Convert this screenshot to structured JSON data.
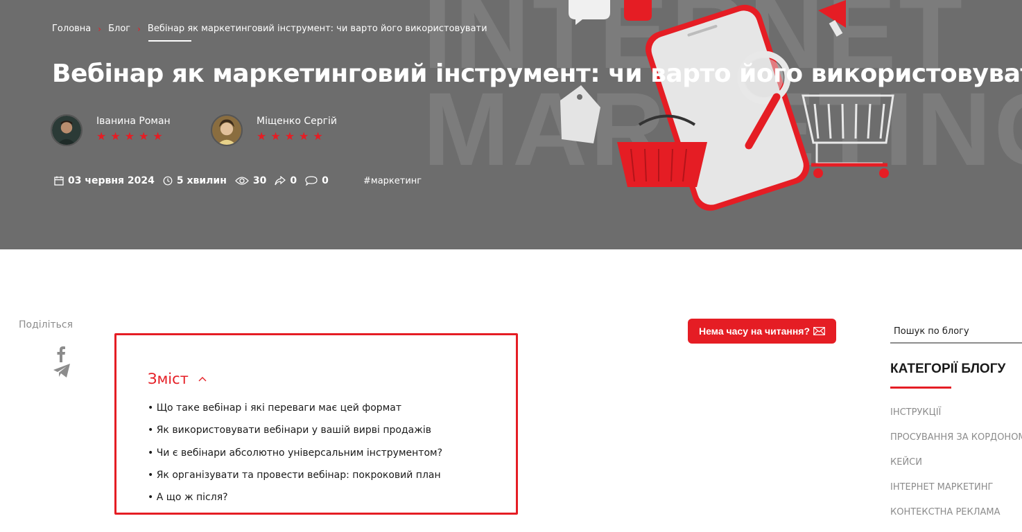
{
  "breadcrumb": {
    "items": [
      "Головна",
      "Блог",
      "Вебінар як маркетинговий інструмент: чи варто його використовувати"
    ],
    "separator": "›"
  },
  "hero": {
    "title": "Вебінар як маркетинговий інструмент: чи варто його використовувати",
    "background_words": [
      "INTERNET",
      "MARKETING"
    ],
    "authors": [
      {
        "name": "Іванина Роман",
        "stars": "★★★★★",
        "rating": 5
      },
      {
        "name": "Міщенко Сергій",
        "stars": "★★★★★",
        "rating": 5
      }
    ],
    "meta": {
      "date": "03 червня 2024",
      "read_time": "5 хвилин",
      "views": "30",
      "shares": "0",
      "comments": "0"
    },
    "tag": "#маркетинг"
  },
  "share": {
    "label": "Поділіться"
  },
  "toc": {
    "title": "Зміст",
    "items": [
      "• Що таке вебінар і які переваги має цей формат",
      "• Як використовувати вебінари у вашій вирві продажів",
      "• Чи є вебінари абсолютно універсальним інструментом?",
      "• Як організувати та провести вебінар: покроковий план",
      "• А що ж після?"
    ]
  },
  "no_time_button": {
    "label": "Нема часу на читання?"
  },
  "sidebar": {
    "search_placeholder": "Пошук по блогу",
    "categories_title": "КАТЕГОРІЇ БЛОГУ",
    "categories": [
      "ІНСТРУКЦІЇ",
      "ПРОСУВАННЯ ЗА КОРДОНОМ",
      "КЕЙСИ",
      "ІНТЕРНЕТ МАРКЕТИНГ",
      "КОНТЕКСТНА РЕКЛАМА"
    ]
  },
  "colors": {
    "accent": "#e51d24",
    "hero_bg": "#6d6d6d",
    "muted_text": "#8c8c8c"
  }
}
